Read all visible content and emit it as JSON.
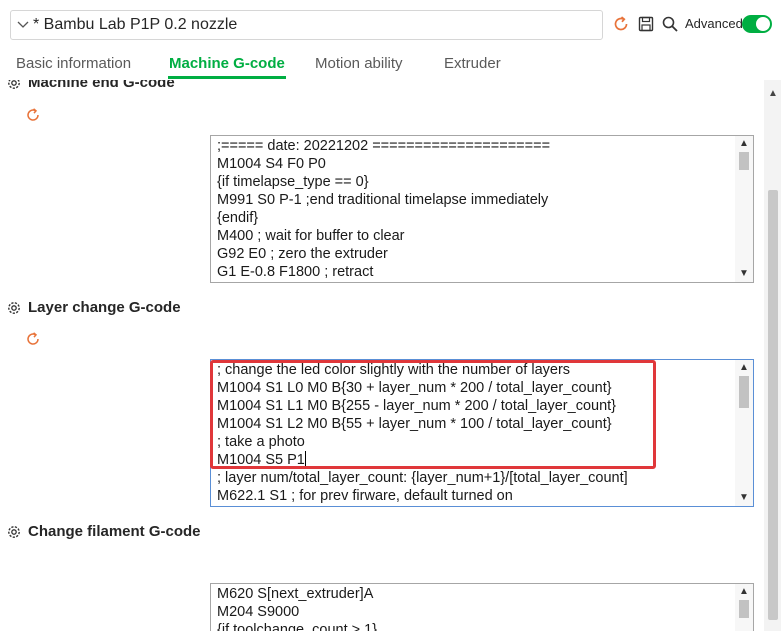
{
  "preset": {
    "name": "* Bambu Lab P1P 0.2 nozzle"
  },
  "toolbar": {
    "advanced_label": "Advanced",
    "advanced_on": true
  },
  "tabs": [
    {
      "label": "Basic information",
      "active": false
    },
    {
      "label": "Machine G-code",
      "active": true
    },
    {
      "label": "Motion ability",
      "active": false
    },
    {
      "label": "Extruder",
      "active": false
    }
  ],
  "sections": {
    "machine_end": {
      "title": "Machine end G-code",
      "lines": [
        ";===== date: 20221202 =====================",
        "M1004 S4 F0 P0",
        "{if timelapse_type == 0}",
        "M991 S0 P-1 ;end traditional timelapse immediately",
        "{endif}",
        "M400 ; wait for buffer to clear",
        "G92 E0 ; zero the extruder",
        "G1 E-0.8 F1800 ; retract"
      ]
    },
    "layer_change": {
      "title": "Layer change G-code",
      "lines": [
        "; change the led color slightly with the number of layers",
        "M1004 S1 L0 M0 B{30 + layer_num * 200 / total_layer_count}",
        "M1004 S1 L1 M0 B{255 - layer_num * 200 / total_layer_count}",
        "M1004 S1 L2 M0 B{55 + layer_num * 100 / total_layer_count}",
        "; take a photo",
        "M1004 S5 P1",
        "; layer num/total_layer_count: {layer_num+1}/[total_layer_count]",
        "M622.1 S1 ; for prev firware, default turned on"
      ]
    },
    "change_filament": {
      "title": "Change filament G-code",
      "lines": [
        "M620 S[next_extruder]A",
        "M204 S9000",
        "{if toolchange_count > 1}"
      ]
    }
  },
  "colors": {
    "accent": "#00ae42",
    "highlight": "#e0373a",
    "focus": "#5a8fd6"
  }
}
